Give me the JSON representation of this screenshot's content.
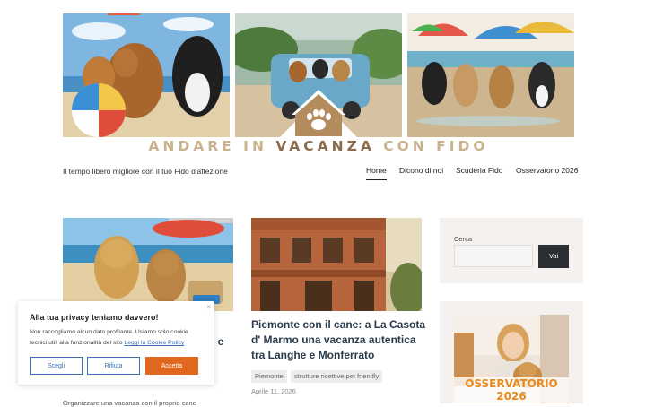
{
  "site": {
    "title_parts": [
      "ANDARE IN ",
      "VACANZA",
      " CON FIDO"
    ],
    "tagline": "Il tempo libero migliore con il tuo Fido d'affezione"
  },
  "nav": [
    {
      "label": "Home",
      "active": true
    },
    {
      "label": "Dicono di noi",
      "active": false
    },
    {
      "label": "Scuderia Fido",
      "active": false
    },
    {
      "label": "Osservatorio 2026",
      "active": false
    }
  ],
  "posts": {
    "left": {
      "title_fragment": "o e",
      "excerpt_fragment": "Organizzare una vacanza con il proprio cane"
    },
    "right": {
      "title": "Piemonte con il cane: a La Casota d' Marmo una vacanza autentica tra Langhe e Monferrato",
      "tags": [
        "Piemonte",
        "strutture ricettive pet friendly"
      ],
      "date": "Aprile 11, 2026"
    }
  },
  "sidebar": {
    "search_label": "Cerca",
    "search_value": "",
    "search_button": "Vai",
    "promo_caption": "OSSERVATORIO 2026"
  },
  "cookie": {
    "title": "Alla tua privacy teniamo davvero!",
    "text": "Non raccogliamo alcun dato profilante. Usiamo solo cookie tecnici utili alla funzionalità del sito",
    "link": "Leggi la Cookie Policy",
    "close": "×",
    "buttons": [
      "Scegli",
      "Rifiuta",
      "Accetta"
    ]
  },
  "colors": {
    "accent": "#e0681e",
    "link": "#3b6fb6",
    "title_dark": "#2a3b4c",
    "logo_gold": "#c9b38e",
    "logo_brown": "#8a6b4a"
  },
  "icons": {
    "logo": "house-paw-icon",
    "close": "close-icon"
  }
}
